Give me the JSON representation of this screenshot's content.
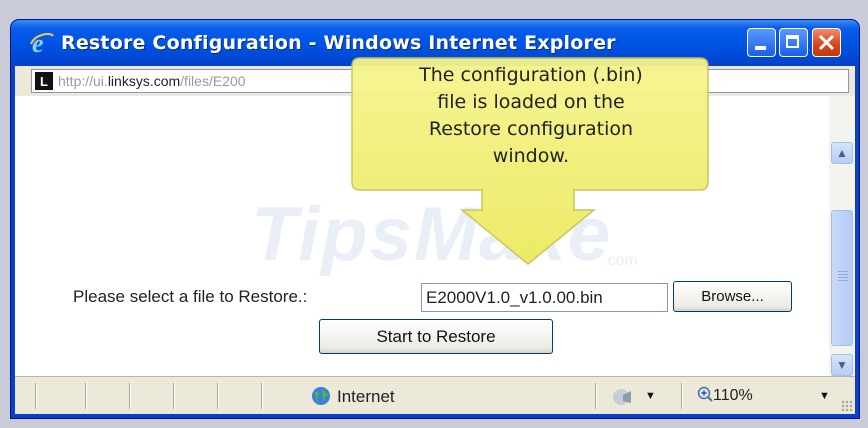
{
  "window": {
    "title": "Restore Configuration - Windows Internet Explorer"
  },
  "address": {
    "site_initial": "L",
    "url_prefix": "http://ui.",
    "url_domain": "linksys.com",
    "url_path": "/files/E200"
  },
  "watermark": {
    "text": "TipsMake",
    "suffix": ".com"
  },
  "form": {
    "select_label": "Please select a file to Restore.:",
    "file_value": "E2000V1.0_v1.0.00.bin",
    "browse_label": "Browse...",
    "restore_label": "Start to Restore"
  },
  "callout": {
    "line1": "The configuration (.bin)",
    "line2": "file is loaded on the",
    "line3": "Restore configuration",
    "line4": "window."
  },
  "statusbar": {
    "zone": "Internet",
    "zoom": "110%"
  },
  "colors": {
    "titlebar": "#0055e5",
    "callout_fill": "#f3f27a",
    "callout_border": "#c7c45a",
    "close_button": "#d8441c"
  },
  "icons": [
    "ie-icon",
    "minimize-icon",
    "maximize-icon",
    "close-icon",
    "linksys-icon",
    "scroll-up-icon",
    "scroll-down-icon",
    "globe-icon",
    "protected-mode-icon",
    "zoom-icon"
  ]
}
